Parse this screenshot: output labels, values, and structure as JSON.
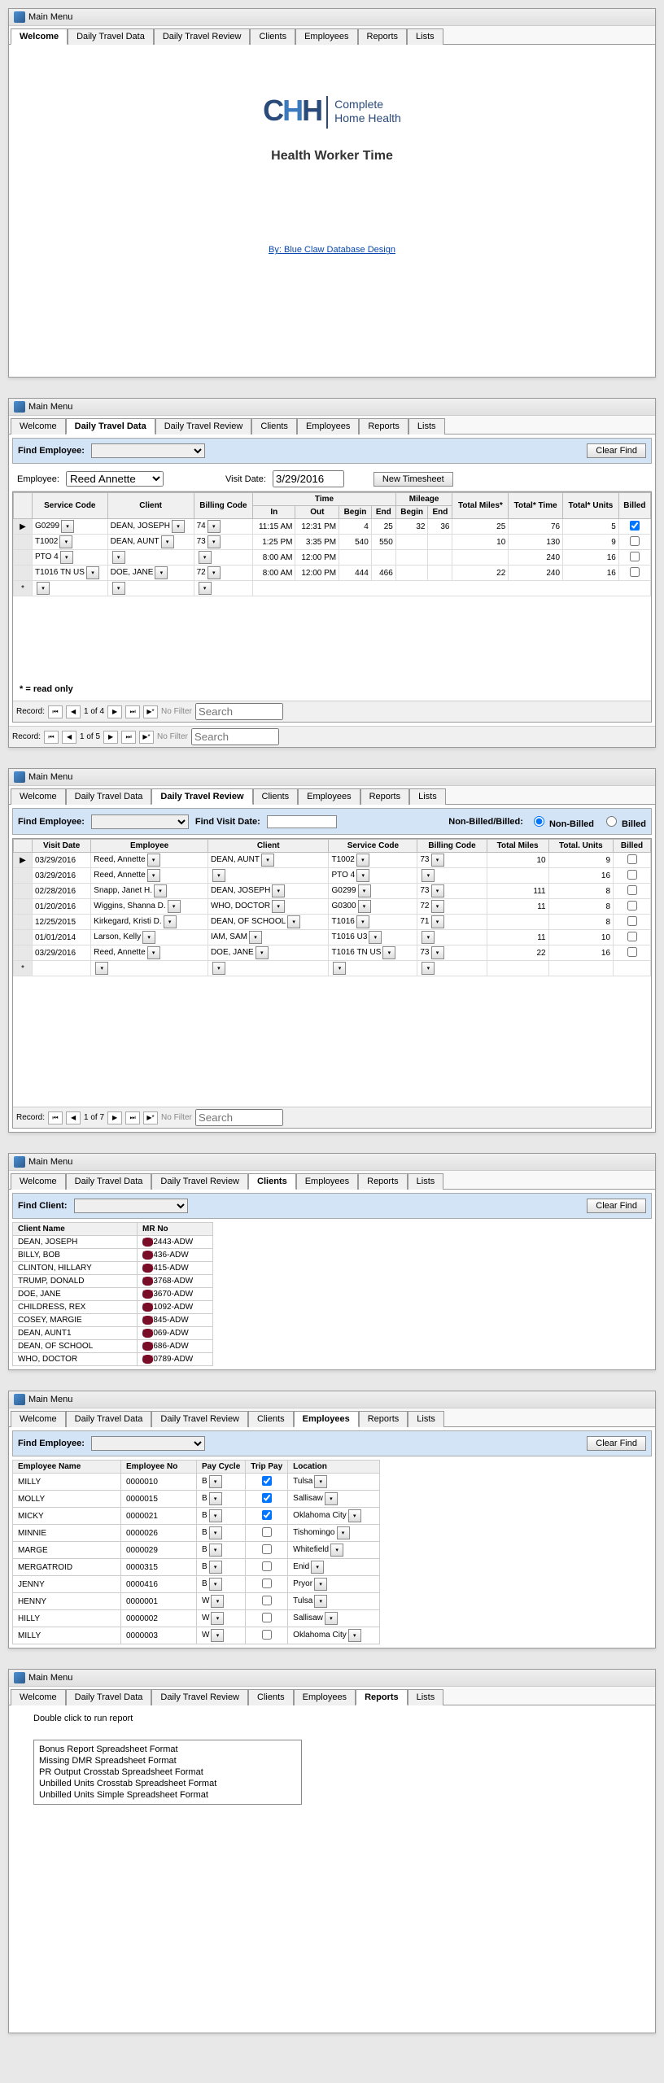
{
  "window_title": "Main Menu",
  "tabs": [
    "Welcome",
    "Daily Travel Data",
    "Daily Travel Review",
    "Clients",
    "Employees",
    "Reports",
    "Lists"
  ],
  "welcome": {
    "logo_company1": "Complete",
    "logo_company2": "Home Health",
    "title": "Health Worker Time",
    "credit": "By: Blue Claw Database Design"
  },
  "daily_data": {
    "find_label": "Find Employee:",
    "clear_btn": "Clear Find",
    "emp_label": "Employee:",
    "emp_value": "Reed Annette",
    "visit_date_label": "Visit Date:",
    "visit_date_value": "3/29/2016",
    "new_btn": "New Timesheet",
    "section_time": "Time",
    "section_mileage": "Mileage",
    "headers": [
      "Service Code",
      "Client",
      "Billing Code",
      "In",
      "Out",
      "Begin",
      "End",
      "Begin",
      "End",
      "Total Miles*",
      "Total* Time",
      "Total* Units",
      "Billed"
    ],
    "rows": [
      {
        "sc": "G0299",
        "client": "DEAN, JOSEPH",
        "bc": "74",
        "in": "11:15 AM",
        "out": "12:31 PM",
        "tb": "4",
        "te": "25",
        "mb": "32",
        "me": "36",
        "miles": "25",
        "time": "76",
        "units": "5",
        "billed": true
      },
      {
        "sc": "T1002",
        "client": "DEAN, AUNT",
        "bc": "73",
        "in": "1:25 PM",
        "out": "3:35 PM",
        "tb": "540",
        "te": "550",
        "mb": "",
        "me": "",
        "miles": "10",
        "time": "130",
        "units": "9",
        "billed": false
      },
      {
        "sc": "PTO 4",
        "client": "",
        "bc": "",
        "in": "8:00 AM",
        "out": "12:00 PM",
        "tb": "",
        "te": "",
        "mb": "",
        "me": "",
        "miles": "",
        "time": "240",
        "units": "16",
        "billed": false
      },
      {
        "sc": "T1016 TN US",
        "client": "DOE, JANE",
        "bc": "72",
        "in": "8:00 AM",
        "out": "12:00 PM",
        "tb": "444",
        "te": "466",
        "mb": "",
        "me": "",
        "miles": "22",
        "time": "240",
        "units": "16",
        "billed": false
      }
    ],
    "readonly": "* = read only",
    "nav_inner": "1 of 4",
    "nav_outer": "1 of 5",
    "no_filter": "No Filter",
    "search": "Search",
    "record_label": "Record:"
  },
  "daily_review": {
    "find_label": "Find Employee:",
    "find_visit": "Find Visit Date:",
    "nb_label": "Non-Billed/Billed:",
    "opt1": "Non-Billed",
    "opt2": "Billed",
    "headers": [
      "Visit Date",
      "Employee",
      "Client",
      "Service Code",
      "Billing Code",
      "Total Miles",
      "Total. Units",
      "Billed"
    ],
    "rows": [
      {
        "vd": "03/29/2016",
        "emp": "Reed, Annette",
        "client": "DEAN, AUNT",
        "sc": "T1002",
        "bc": "73",
        "miles": "10",
        "units": "9",
        "billed": false
      },
      {
        "vd": "03/29/2016",
        "emp": "Reed, Annette",
        "client": "",
        "sc": "PTO 4",
        "bc": "",
        "miles": "",
        "units": "16",
        "billed": false
      },
      {
        "vd": "02/28/2016",
        "emp": "Snapp, Janet H.",
        "client": "DEAN, JOSEPH",
        "sc": "G0299",
        "bc": "73",
        "miles": "111",
        "units": "8",
        "billed": false
      },
      {
        "vd": "01/20/2016",
        "emp": "Wiggins, Shanna D.",
        "client": "WHO, DOCTOR",
        "sc": "G0300",
        "bc": "72",
        "miles": "11",
        "units": "8",
        "billed": false
      },
      {
        "vd": "12/25/2015",
        "emp": "Kirkegard, Kristi D.",
        "client": "DEAN, OF SCHOOL",
        "sc": "T1016",
        "bc": "71",
        "miles": "",
        "units": "8",
        "billed": false
      },
      {
        "vd": "01/01/2014",
        "emp": "Larson, Kelly",
        "client": "IAM, SAM",
        "sc": "T1016 U3",
        "bc": "",
        "miles": "11",
        "units": "10",
        "billed": false
      },
      {
        "vd": "03/29/2016",
        "emp": "Reed, Annette",
        "client": "DOE, JANE",
        "sc": "T1016 TN US",
        "bc": "73",
        "miles": "22",
        "units": "16",
        "billed": false
      }
    ],
    "nav": "1 of 7"
  },
  "clients": {
    "find_label": "Find Client:",
    "clear_btn": "Clear Find",
    "headers": [
      "Client Name",
      "MR No"
    ],
    "rows": [
      {
        "name": "DEAN, JOSEPH",
        "mr": "2443-ADW"
      },
      {
        "name": "BILLY, BOB",
        "mr": "436-ADW"
      },
      {
        "name": "CLINTON, HILLARY",
        "mr": "415-ADW"
      },
      {
        "name": "TRUMP, DONALD",
        "mr": "3768-ADW"
      },
      {
        "name": "DOE, JANE",
        "mr": "3670-ADW"
      },
      {
        "name": "CHILDRESS, REX",
        "mr": "1092-ADW"
      },
      {
        "name": "COSEY, MARGIE",
        "mr": "845-ADW"
      },
      {
        "name": "DEAN, AUNT1",
        "mr": "069-ADW"
      },
      {
        "name": "DEAN, OF SCHOOL",
        "mr": "686-ADW"
      },
      {
        "name": "WHO, DOCTOR",
        "mr": "0789-ADW"
      }
    ]
  },
  "employees": {
    "find_label": "Find Employee:",
    "clear_btn": "Clear Find",
    "headers": [
      "Employee Name",
      "Employee No",
      "Pay Cycle",
      "Trip Pay",
      "Location"
    ],
    "rows": [
      {
        "name": "MILLY",
        "no": "0000010",
        "pc": "B",
        "tp": true,
        "loc": "Tulsa"
      },
      {
        "name": "MOLLY",
        "no": "0000015",
        "pc": "B",
        "tp": true,
        "loc": "Sallisaw"
      },
      {
        "name": "MICKY",
        "no": "0000021",
        "pc": "B",
        "tp": true,
        "loc": "Oklahoma City"
      },
      {
        "name": "MINNIE",
        "no": "0000026",
        "pc": "B",
        "tp": false,
        "loc": "Tishomingo"
      },
      {
        "name": "MARGE",
        "no": "0000029",
        "pc": "B",
        "tp": false,
        "loc": "Whitefield"
      },
      {
        "name": "MERGATROID",
        "no": "0000315",
        "pc": "B",
        "tp": false,
        "loc": "Enid"
      },
      {
        "name": "JENNY",
        "no": "0000416",
        "pc": "B",
        "tp": false,
        "loc": "Pryor"
      },
      {
        "name": "HENNY",
        "no": "0000001",
        "pc": "W",
        "tp": false,
        "loc": "Tulsa"
      },
      {
        "name": "HILLY",
        "no": "0000002",
        "pc": "W",
        "tp": false,
        "loc": "Sallisaw"
      },
      {
        "name": "MILLY",
        "no": "0000003",
        "pc": "W",
        "tp": false,
        "loc": "Oklahoma City"
      }
    ]
  },
  "reports": {
    "heading": "Double click to run report",
    "items": [
      "Bonus Report Spreadsheet Format",
      "Missing DMR Spreadsheet Format",
      "PR Output Crosstab Spreadsheet Format",
      "Unbilled Units Crosstab  Spreadsheet Format",
      "Unbilled Units Simple  Spreadsheet Format"
    ]
  }
}
